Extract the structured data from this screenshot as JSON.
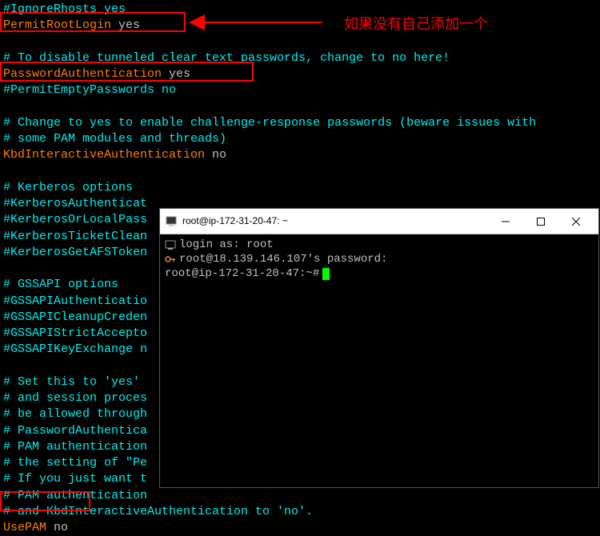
{
  "config_lines": [
    {
      "parts": [
        {
          "cls": "comment",
          "text": "#IgnoreRhosts yes"
        }
      ]
    },
    {
      "parts": [
        {
          "cls": "directive",
          "text": "PermitRootLogin"
        },
        {
          "cls": "value",
          "text": " yes"
        }
      ]
    },
    {
      "parts": [
        {
          "cls": "",
          "text": " "
        }
      ]
    },
    {
      "parts": [
        {
          "cls": "comment",
          "text": "# To disable tunneled clear text passwords, change to no here!"
        }
      ]
    },
    {
      "parts": [
        {
          "cls": "directive",
          "text": "PasswordAuthentication"
        },
        {
          "cls": "value",
          "text": " yes"
        }
      ]
    },
    {
      "parts": [
        {
          "cls": "comment",
          "text": "#PermitEmptyPasswords no"
        }
      ]
    },
    {
      "parts": [
        {
          "cls": "",
          "text": " "
        }
      ]
    },
    {
      "parts": [
        {
          "cls": "comment",
          "text": "# Change to yes to enable challenge-response passwords (beware issues with"
        }
      ]
    },
    {
      "parts": [
        {
          "cls": "comment",
          "text": "# some PAM modules and threads)"
        }
      ]
    },
    {
      "parts": [
        {
          "cls": "directive",
          "text": "KbdInteractiveAuthentication"
        },
        {
          "cls": "value",
          "text": " no"
        }
      ]
    },
    {
      "parts": [
        {
          "cls": "",
          "text": " "
        }
      ]
    },
    {
      "parts": [
        {
          "cls": "comment",
          "text": "# Kerberos options"
        }
      ]
    },
    {
      "parts": [
        {
          "cls": "comment",
          "text": "#KerberosAuthenticat"
        }
      ]
    },
    {
      "parts": [
        {
          "cls": "comment",
          "text": "#KerberosOrLocalPass"
        }
      ]
    },
    {
      "parts": [
        {
          "cls": "comment",
          "text": "#KerberosTicketClean"
        }
      ]
    },
    {
      "parts": [
        {
          "cls": "comment",
          "text": "#KerberosGetAFSToken"
        }
      ]
    },
    {
      "parts": [
        {
          "cls": "",
          "text": " "
        }
      ]
    },
    {
      "parts": [
        {
          "cls": "comment",
          "text": "# GSSAPI options"
        }
      ]
    },
    {
      "parts": [
        {
          "cls": "comment",
          "text": "#GSSAPIAuthenticatio"
        }
      ]
    },
    {
      "parts": [
        {
          "cls": "comment",
          "text": "#GSSAPICleanupCreden"
        }
      ]
    },
    {
      "parts": [
        {
          "cls": "comment",
          "text": "#GSSAPIStrictAccepto"
        }
      ]
    },
    {
      "parts": [
        {
          "cls": "comment",
          "text": "#GSSAPIKeyExchange n"
        }
      ]
    },
    {
      "parts": [
        {
          "cls": "",
          "text": " "
        }
      ]
    },
    {
      "parts": [
        {
          "cls": "comment",
          "text": "# Set this to 'yes' "
        }
      ]
    },
    {
      "parts": [
        {
          "cls": "comment",
          "text": "# and session proces"
        }
      ]
    },
    {
      "parts": [
        {
          "cls": "comment",
          "text": "# be allowed through"
        }
      ]
    },
    {
      "parts": [
        {
          "cls": "comment",
          "text": "# PasswordAuthentica"
        }
      ]
    },
    {
      "parts": [
        {
          "cls": "comment",
          "text": "# PAM authentication"
        }
      ]
    },
    {
      "parts": [
        {
          "cls": "comment",
          "text": "# the setting of \"Pe"
        }
      ]
    },
    {
      "parts": [
        {
          "cls": "comment",
          "text": "# If you just want t"
        }
      ]
    },
    {
      "parts": [
        {
          "cls": "comment",
          "text": "# PAM authentication"
        }
      ]
    },
    {
      "parts": [
        {
          "cls": "comment",
          "text": "# and KbdInteractiveAuthentication to 'no'."
        }
      ]
    },
    {
      "parts": [
        {
          "cls": "directive",
          "text": "UsePAM"
        },
        {
          "cls": "value",
          "text": " no"
        }
      ]
    }
  ],
  "annotation": "如果没有自己添加一个",
  "putty": {
    "title": "root@ip-172-31-20-47: ~",
    "lines": {
      "l1": "login as: root",
      "l2": "root@18.139.146.107's password:",
      "l3": "root@ip-172-31-20-47:~# "
    }
  }
}
